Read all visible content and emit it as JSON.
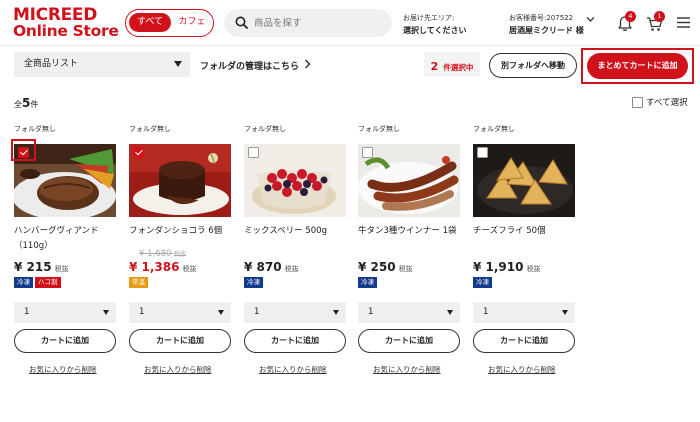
{
  "header": {
    "logo_line1": "MICREED",
    "logo_line2": "Online Store",
    "toggle": {
      "all": "すべて",
      "cafe": "カフェ"
    },
    "search_placeholder": "商品を探す",
    "delivery_label": "お届け先エリア:",
    "delivery_value": "選択してください",
    "customer_label": "お客様番号:207522",
    "customer_name": "居酒屋ミクリード 様",
    "notifications_count": "4",
    "cart_count": "1",
    "icons": [
      "search-icon",
      "chevron-down-icon",
      "bell-icon",
      "cart-icon",
      "menu-icon"
    ]
  },
  "toolbar": {
    "list_select": "全商品リスト",
    "folder_link": "フォルダの管理はこちら",
    "selected_num": "2",
    "selected_label": "件選択中",
    "move_button": "別フォルダへ移動",
    "bulk_cart_button": "まとめてカートに追加"
  },
  "summary": {
    "prefix": "全",
    "count": "5",
    "suffix": "件",
    "select_all": "すべて選択"
  },
  "colors": {
    "brand_red": "#d0121b",
    "tag_blue": "#123a8c",
    "tag_orange": "#e89a10"
  },
  "products": [
    {
      "folder": "フォルダ無し",
      "name": "ハンバーグヴィアンド（110g）",
      "old_price": "",
      "price": "¥ 215",
      "tax": "税抜",
      "tags": [
        {
          "label": "冷凍",
          "color": "blue"
        },
        {
          "label": "ハコ割",
          "color": "red"
        }
      ],
      "checked": true,
      "qty": "1",
      "cart_label": "カートに追加",
      "remove_label": "お気に入りから削除",
      "image": "hamburger-steak"
    },
    {
      "folder": "フォルダ無し",
      "name": "フォンダンショコラ 6個",
      "old_price": "¥ 1,680",
      "price": "¥ 1,386",
      "tax": "税抜",
      "tags": [
        {
          "label": "常温",
          "color": "orange"
        }
      ],
      "checked": true,
      "qty": "1",
      "cart_label": "カートに追加",
      "remove_label": "お気に入りから削除",
      "image": "fondant-chocolat"
    },
    {
      "folder": "フォルダ無し",
      "name": "ミックスベリー 500g",
      "old_price": "",
      "price": "¥ 870",
      "tax": "税抜",
      "tags": [
        {
          "label": "冷凍",
          "color": "blue"
        }
      ],
      "checked": false,
      "qty": "1",
      "cart_label": "カートに追加",
      "remove_label": "お気に入りから削除",
      "image": "mixed-berry"
    },
    {
      "folder": "フォルダ無し",
      "name": "牛タン3種ウインナー 1袋",
      "old_price": "",
      "price": "¥ 250",
      "tax": "税抜",
      "tags": [
        {
          "label": "冷凍",
          "color": "blue"
        }
      ],
      "checked": false,
      "qty": "1",
      "cart_label": "カートに追加",
      "remove_label": "お気に入りから削除",
      "image": "sausages"
    },
    {
      "folder": "フォルダ無し",
      "name": "チーズフライ 50個",
      "old_price": "",
      "price": "¥ 1,910",
      "tax": "税抜",
      "tags": [
        {
          "label": "冷凍",
          "color": "blue"
        }
      ],
      "checked": false,
      "qty": "1",
      "cart_label": "カートに追加",
      "remove_label": "お気に入りから削除",
      "image": "cheese-fry"
    }
  ]
}
